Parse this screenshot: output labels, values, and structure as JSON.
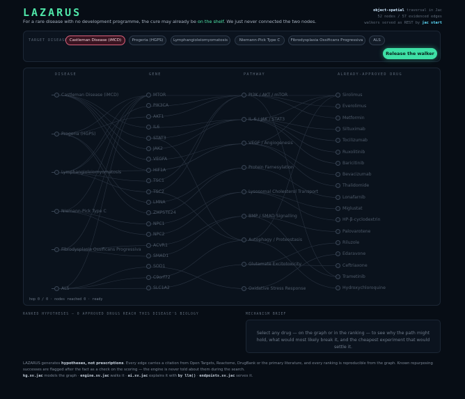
{
  "header": {
    "logo": "LAZARUS",
    "tagline_pre": "For a rare disease with no development programme, the cure may already be ",
    "tagline_hl": "on the shelf",
    "tagline_post": ". We just never connected the two nodes.",
    "meta_b": "object-spatial",
    "meta_1": " traversal in Jac",
    "meta_2": "52 nodes / 57 evidenced edges",
    "meta_3": "walkers served as REST by ",
    "meta_j": "jac start"
  },
  "target": {
    "label": "TARGET DISEASE",
    "chips": [
      {
        "label": "Castleman Disease (iMCD)",
        "selected": true
      },
      {
        "label": "Progeria (HGPS)",
        "selected": false
      },
      {
        "label": "Lymphangioleiomyomatosis",
        "selected": false
      },
      {
        "label": "Niemann-Pick Type C",
        "selected": false
      },
      {
        "label": "Fibrodysplasia Ossificans Progressiva",
        "selected": false
      },
      {
        "label": "ALS",
        "selected": false
      }
    ],
    "button": "Release the walker"
  },
  "graph": {
    "headers": [
      "DISEASE",
      "GENE",
      "PATHWAY",
      "ALREADY-APPROVED DRUG"
    ],
    "diseases": [
      "Castleman Disease (iMCD)",
      "Progeria (HGPS)",
      "Lymphangioleiomyomatosis",
      "Niemann-Pick Type C",
      "Fibrodysplasia Ossificans Progressiva",
      "ALS"
    ],
    "genes": [
      "MTOR",
      "PIK3CA",
      "AKT1",
      "IL6",
      "STAT3",
      "JAK2",
      "VEGFA",
      "HIF1A",
      "TSC1",
      "TSC2",
      "LMNA",
      "ZMPSTE24",
      "NPC1",
      "NPC2",
      "ACVR1",
      "SMAD1",
      "SOD1",
      "C9orf72",
      "SLC1A2"
    ],
    "pathways": [
      "PI3K / AKT / mTOR",
      "IL-6 / JAK / STAT3",
      "VEGF / Angiogenesis",
      "Protein Farnesylation",
      "Lysosomal Cholesterol Transport",
      "BMP / SMAD Signalling",
      "Autophagy / Proteostasis",
      "Glutamate Excitotoxicity",
      "Oxidative Stress Response"
    ],
    "drugs": [
      "Sirolimus",
      "Everolimus",
      "Metformin",
      "Siltuximab",
      "Tocilizumab",
      "Ruxolitinib",
      "Baricitinib",
      "Bevacizumab",
      "Thalidomide",
      "Lonafarnib",
      "Miglustat",
      "HP-β-cyclodextrin",
      "Palovarotene",
      "Riluzole",
      "Edaravone",
      "Ceftriaxone",
      "Trametinib",
      "Hydroxychloroquine"
    ],
    "status": "hop 0 / 0 · nodes reached 0 · ready"
  },
  "ranked": {
    "header": "RANKED HYPOTHESES — 0 APPROVED DRUGS REACH THIS DISEASE'S BIOLOGY"
  },
  "mechanism": {
    "header": "MECHANISM BRIEF",
    "text": "Select any drug — on the graph or in the ranking — to see why the path might hold, what would most likely break it, and the cheapest experiment that would settle it."
  },
  "footer": {
    "p1_a": "LAZARUS generates ",
    "p1_b": "hypotheses, not prescriptions",
    "p1_c": ". Every edge carries a citation from Open Targets, Reactome, DrugBank or the primary literature, and every ranking is reproducible from the graph. Known repurposing successes are flagged after the fact as a check on the scoring — the engine is never told about them during the search.",
    "f1": "kg.sv.jac",
    "t1": " models the graph · ",
    "f2": "engine.sv.jac",
    "t2": " walks it · ",
    "f3": "ai.sv.jac",
    "t3": " explains it with ",
    "f4": "by llm()",
    "t4": " · ",
    "f5": "endpoints.sv.jac",
    "t5": " serves it."
  }
}
